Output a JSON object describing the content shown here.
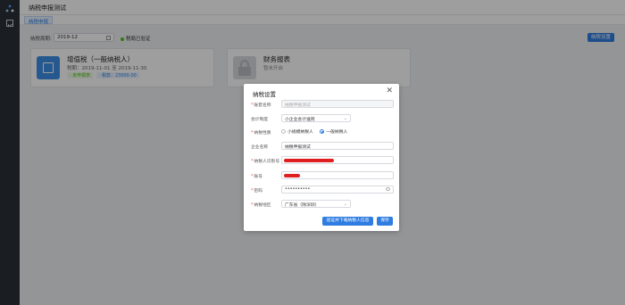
{
  "header": {
    "title": "纳税申报测试"
  },
  "tabs": [
    {
      "label": "纳税申报"
    }
  ],
  "filters": {
    "period_label": "纳税周期:",
    "period_value": "2019-12",
    "status_text": "税局已验证"
  },
  "toolbar": {
    "settings_label": "纳税设置"
  },
  "cards": [
    {
      "title": "增值税（一般纳税人）",
      "subtitle": "税期：2019-11-01 至 2019-11-30",
      "tag1": "· 未申报表",
      "tag2": "· 税款：23000.00"
    },
    {
      "title": "财务报表",
      "subtitle": "暂未开启"
    }
  ],
  "dialog": {
    "title": "纳税设置",
    "close": "✕",
    "fields": {
      "book_name": {
        "label": "账套名称",
        "value": "纳税申报测试"
      },
      "accounting_system": {
        "label": "会计制度",
        "value": "小企业会计准则"
      },
      "taxpayer_type": {
        "label": "纳税性质",
        "option1": "小规模纳税人",
        "option2": "一般纳税人",
        "selected": "一般纳税人"
      },
      "company_name": {
        "label": "企业名称",
        "value": "纳税申报测试"
      },
      "taxpayer_id": {
        "label": "纳税人识别号"
      },
      "account": {
        "label": "账号"
      },
      "password": {
        "label": "密码",
        "value": "••••••••••"
      },
      "tax_region": {
        "label": "纳税地区",
        "value": "广东省（除深圳）"
      }
    },
    "verify_button": "验证并下载纳税人信息",
    "save_button": "保存"
  },
  "colors": {
    "accent": "#2f7de1",
    "redaction": "#e02020",
    "status_green": "#52c41a"
  }
}
